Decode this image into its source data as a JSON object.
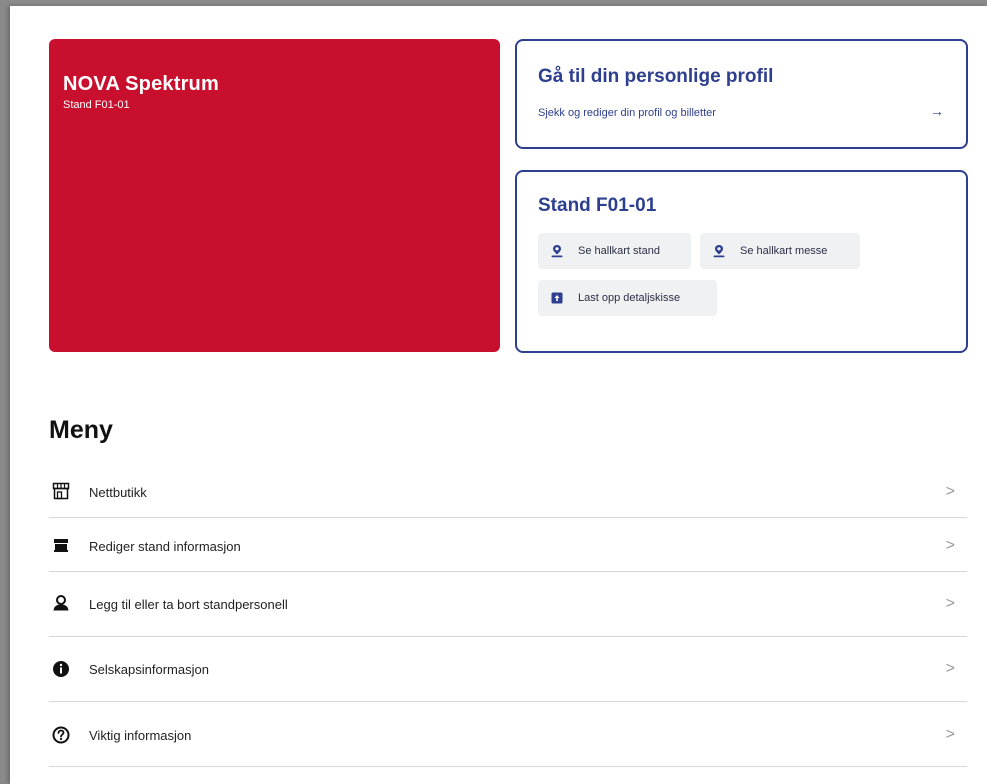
{
  "company": {
    "name": "NOVA Spektrum",
    "stand": "Stand F01-01",
    "color": "#c8102e"
  },
  "profile": {
    "title": "Gå til din personlige profil",
    "subtitle": "Sjekk og rediger din profil og billetter",
    "arrow": "→"
  },
  "stand": {
    "title": "Stand F01-01",
    "actions": [
      {
        "label": "Se hallkart stand",
        "icon": "map-pin-person-icon"
      },
      {
        "label": "Se hallkart messe",
        "icon": "map-pin-person-icon"
      },
      {
        "label": "Last opp detaljskisse",
        "icon": "upload-icon"
      }
    ]
  },
  "menu": {
    "title": "Meny",
    "items": [
      {
        "label": "Nettbutikk",
        "icon": "store-icon"
      },
      {
        "label": "Rediger stand informasjon",
        "icon": "stand-icon"
      },
      {
        "label": "Legg til eller ta bort standpersonell",
        "icon": "people-icon"
      },
      {
        "label": "Selskapsinformasjon",
        "icon": "info-icon"
      },
      {
        "label": "Viktig informasjon",
        "icon": "question-icon"
      }
    ],
    "chevron": ">"
  },
  "colors": {
    "accent": "#2e3f8f",
    "brand_red": "#c8102e"
  }
}
